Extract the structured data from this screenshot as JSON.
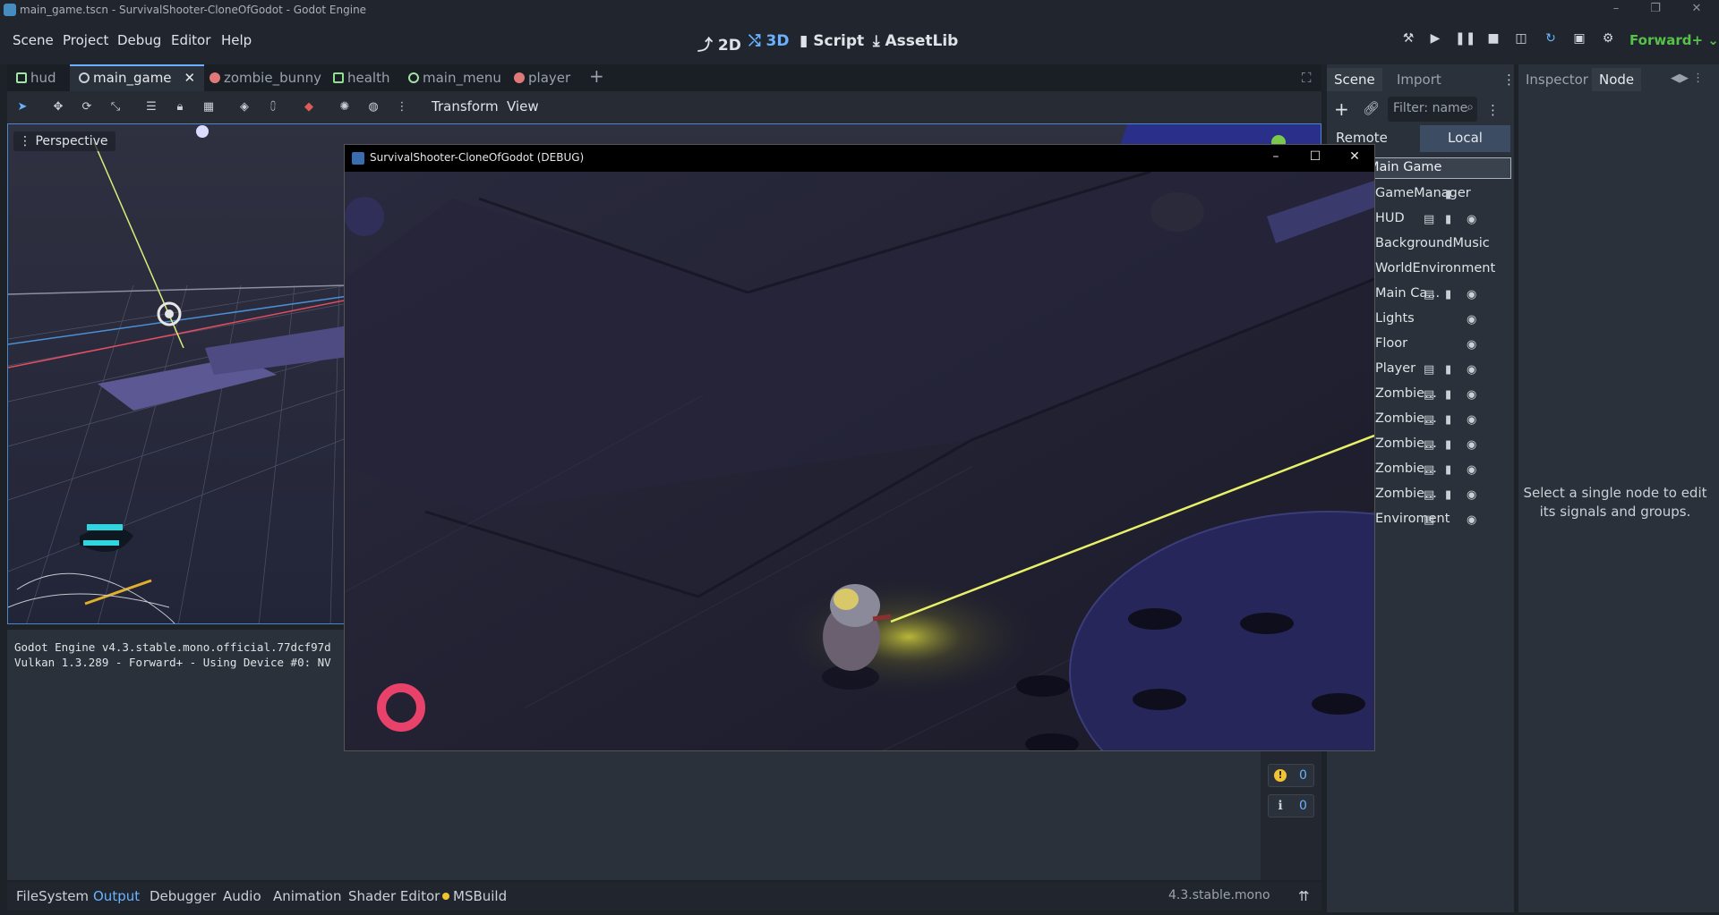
{
  "titlebar": {
    "title": "main_game.tscn - SurvivalShooter-CloneOfGodot - Godot Engine"
  },
  "menu": {
    "items": [
      "Scene",
      "Project",
      "Debug",
      "Editor",
      "Help"
    ]
  },
  "workspaces": {
    "w2d": "2D",
    "w3d": "3D",
    "script": "Script",
    "assetlib": "AssetLib"
  },
  "renderer": "Forward+",
  "scene_tabs": [
    "hud",
    "main_game",
    "zombie_bunny",
    "health",
    "main_menu",
    "player"
  ],
  "viewport": {
    "toolbar": {
      "transform": "Transform",
      "view": "View"
    },
    "perspective": "Perspective"
  },
  "output": {
    "lines": [
      "Godot Engine v4.3.stable.mono.official.77dcf97d",
      "Vulkan 1.3.289 - Forward+ - Using Device #0: NV"
    ],
    "warnings": "0",
    "messages": "0"
  },
  "bottom_tabs": [
    "FileSystem",
    "Output",
    "Debugger",
    "Audio",
    "Animation",
    "Shader Editor",
    "MSBuild"
  ],
  "version": "4.3.stable.mono",
  "scene_dock": {
    "tabs": [
      "Scene",
      "Import"
    ],
    "filter_placeholder": "Filter: name",
    "remote": "Remote",
    "local": "Local",
    "root": "Main Game",
    "nodes": [
      "GameManager",
      "HUD",
      "BackgroundMusic",
      "WorldEnvironment",
      "Main Ca...",
      "Lights",
      "Floor",
      "Player",
      "Zombie...",
      "Zombie...",
      "Zombie...",
      "Zombie...",
      "Zombie...",
      "Enviroment"
    ]
  },
  "node_dock": {
    "tabs": [
      "Inspector",
      "Node"
    ],
    "message": "Select a single node to edit its signals and groups."
  },
  "game_window": {
    "title": "SurvivalShooter-CloneOfGodot (DEBUG)"
  },
  "colors": {
    "accent": "#6ab2ff",
    "renderer": "#57c24a",
    "laser": "#e8f06a",
    "health_ring": "#e8416a"
  }
}
